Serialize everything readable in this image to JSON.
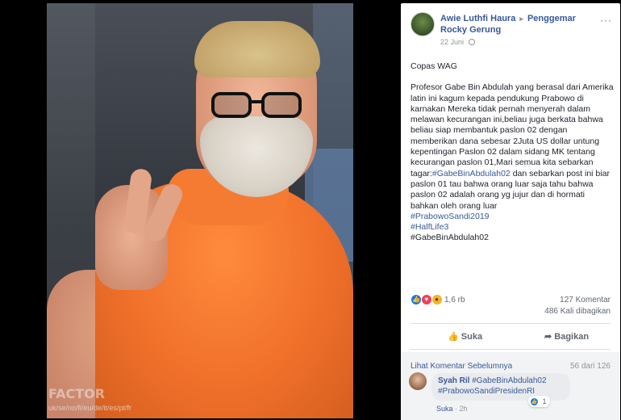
{
  "photo": {
    "watermark": "FACTOR",
    "watermark_url": "uk/se/no/fi/eu/de/it/es/pt/fr"
  },
  "post": {
    "author": "Awie Luthfi Haura",
    "arrow": "▸",
    "group": "Penggemar Rocky Gerung",
    "date": "22 Juni",
    "more": "···",
    "text": {
      "p1": "Copas WAG",
      "p2_main": "Profesor Gabe Bin Abdulah yang berasal dari Amerika latin ini kagum kepada pendukung Prabowo di karnakan Mereka tidak pernah menyerah dalam melawan kecurangan ini,beliau juga berkata bahwa beliau siap membantuk paslon 02 dengan memberikan dana sebesar 2Juta US dollar untung kepentingan Paslon 02 dalam sidang MK tentang kecurangan paslon 01,Mari semua kita sebarkan tagar:",
      "hashtag1": "#GabeBinAbdulah02",
      "p2_end": " dan sebarkan post ini biar paslon 01 tau bahwa orang luar saja tahu bahwa paslon 02 adalah orang yg jujur dan di hormati bahkan oleh orang luar",
      "hashtag2": "#PrabowoSandi2019",
      "hashtag3": "#HalfLife3",
      "hashtag4": "#GabeBinAbdulah02"
    },
    "reactions": {
      "count": "1,6 rb",
      "comments": "127 Komentar",
      "shares": "486 Kali dibagikan"
    },
    "actions": {
      "like": "Suka",
      "share": "Bagikan"
    },
    "comments": {
      "previous_link": "Lihat Komentar Sebelumnya",
      "pager": "56 dari 126",
      "items": [
        {
          "author": "Syah Ril",
          "text": "#GabeBinAbdulah02 #PrabowoSandiPresidenRI",
          "reactions": "1",
          "like": "Suka",
          "separator": " · ",
          "time": "2h"
        }
      ]
    }
  },
  "colors": {
    "link": "#385898",
    "name": "#365899",
    "shirt": "#f0702a"
  }
}
